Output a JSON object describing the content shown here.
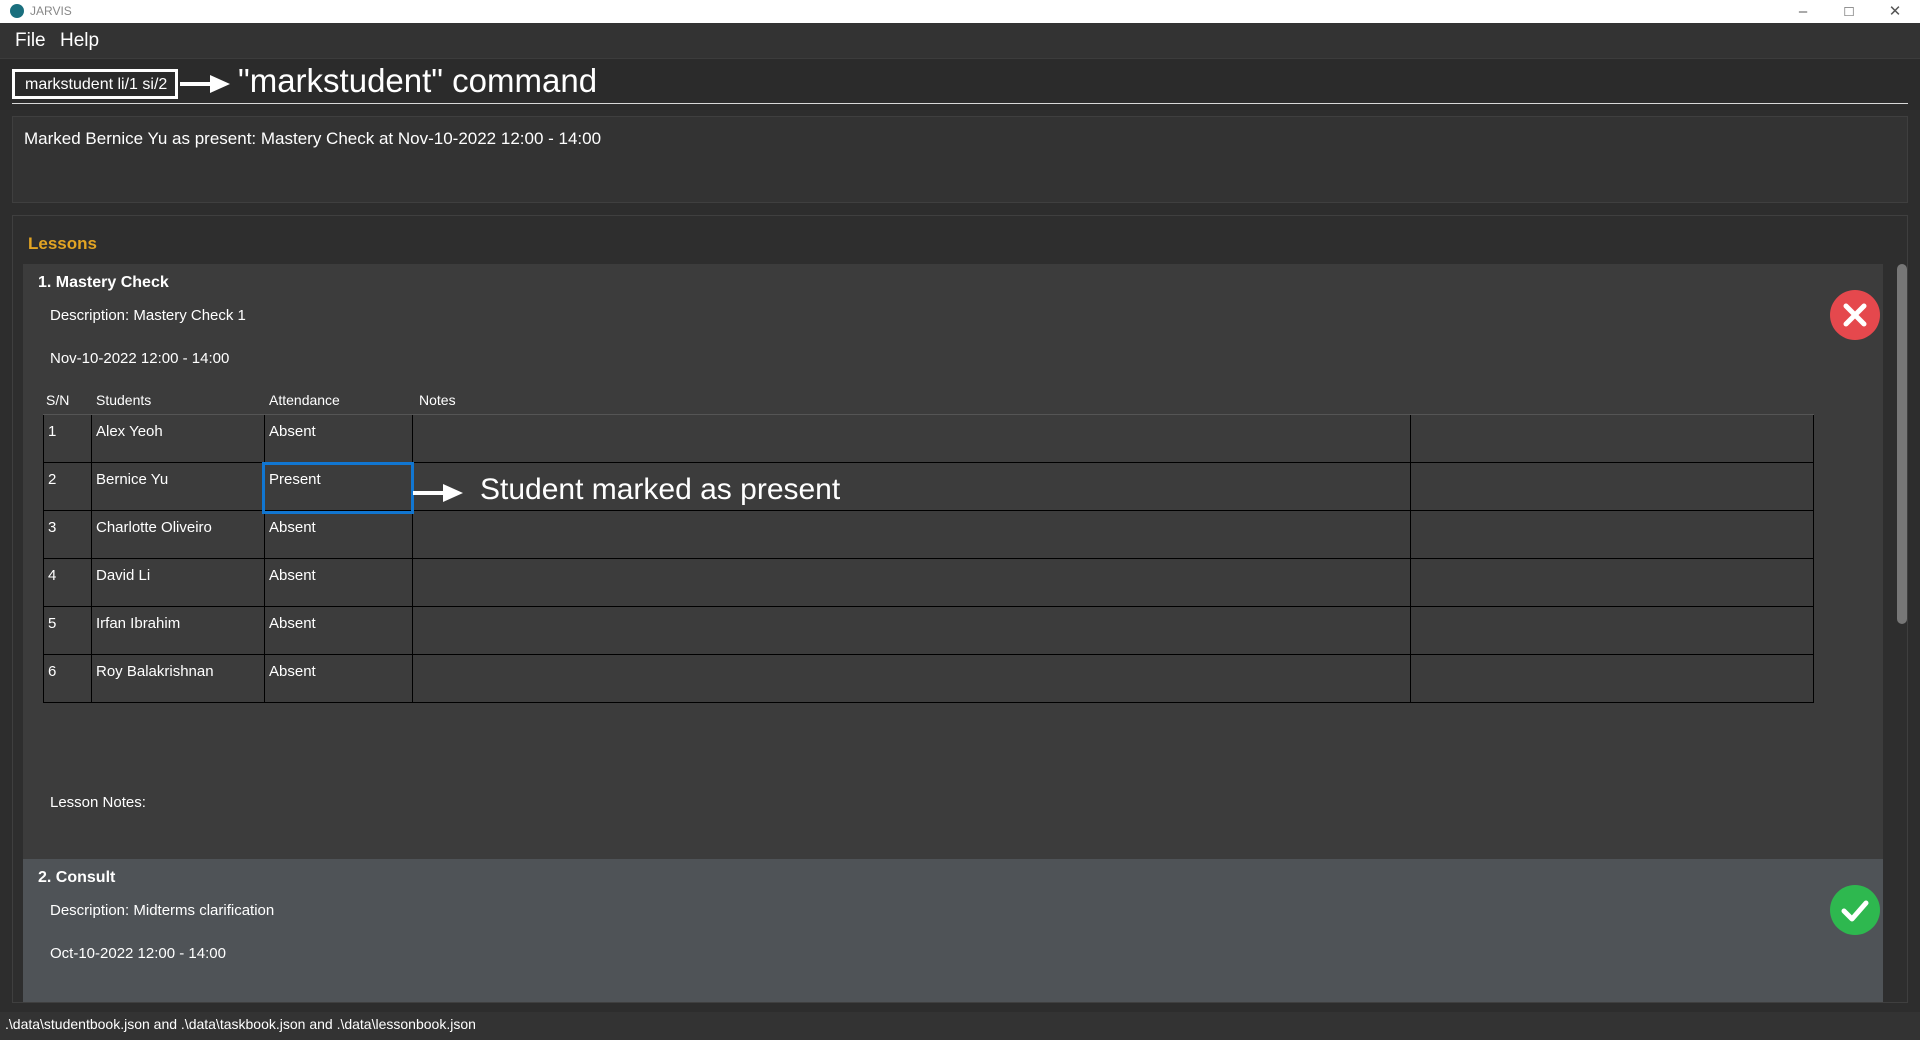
{
  "window": {
    "title": "JARVIS"
  },
  "menu": {
    "file": "File",
    "help": "Help"
  },
  "command": {
    "value": "markstudent li/1 si/2"
  },
  "annotations": {
    "command_label": "\"markstudent\" command",
    "present_label": "Student marked as present"
  },
  "result": {
    "message": "Marked Bernice Yu as present: Mastery Check at Nov-10-2022 12:00 - 14:00"
  },
  "lessons": {
    "heading": "Lessons",
    "items": [
      {
        "title": "1.  Mastery Check",
        "description": "Description: Mastery Check 1",
        "datetime": "Nov-10-2022 12:00 - 14:00",
        "status": "incomplete",
        "status_icon": "x-icon",
        "status_color": "#e5484d",
        "table": {
          "headers": {
            "sn": "S/N",
            "students": "Students",
            "attendance": "Attendance",
            "notes": "Notes"
          },
          "rows": [
            {
              "sn": "1",
              "student": "Alex Yeoh",
              "attendance": "Absent"
            },
            {
              "sn": "2",
              "student": "Bernice Yu",
              "attendance": "Present"
            },
            {
              "sn": "3",
              "student": "Charlotte Oliveiro",
              "attendance": "Absent"
            },
            {
              "sn": "4",
              "student": "David Li",
              "attendance": "Absent"
            },
            {
              "sn": "5",
              "student": "Irfan Ibrahim",
              "attendance": "Absent"
            },
            {
              "sn": "6",
              "student": "Roy Balakrishnan",
              "attendance": "Absent"
            }
          ]
        },
        "notes_label": "Lesson Notes:"
      },
      {
        "title": "2.  Consult",
        "description": "Description: Midterms clarification",
        "datetime": "Oct-10-2022 12:00 - 14:00",
        "status": "complete",
        "status_icon": "check-icon",
        "status_color": "#2eb84f"
      }
    ]
  },
  "statusbar": {
    "path": ".\\data\\studentbook.json and .\\data\\taskbook.json and .\\data\\lessonbook.json"
  },
  "colors": {
    "accent": "#e2a423",
    "highlight": "#1176d1"
  }
}
